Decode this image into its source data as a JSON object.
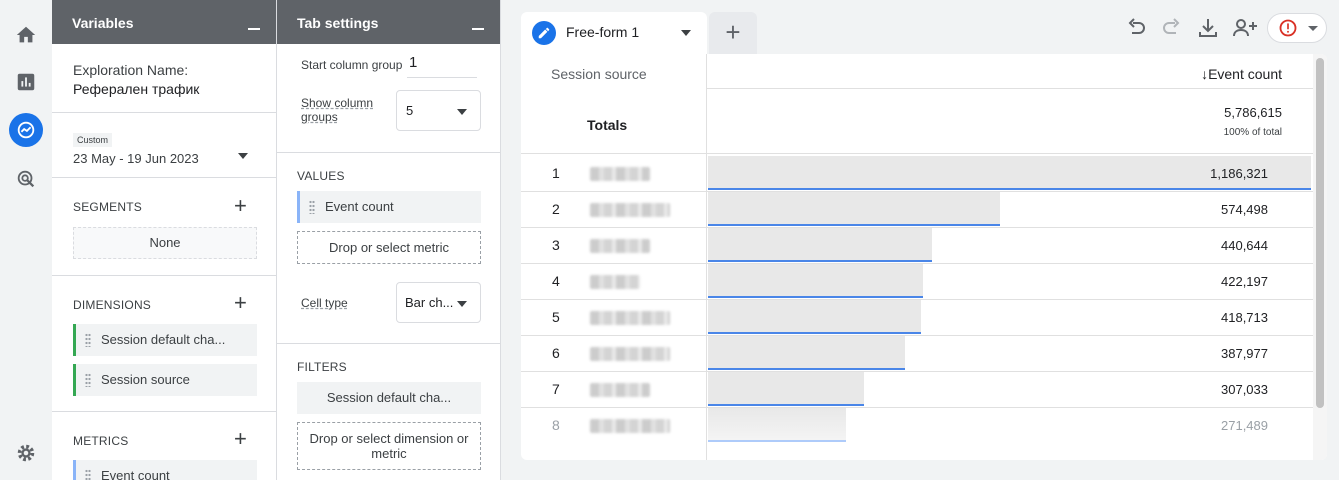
{
  "variables": {
    "title": "Variables",
    "exploration_label": "Exploration Name:",
    "exploration_name": "Реферален трафик",
    "date_badge": "Custom",
    "date_range": "23 May - 19 Jun 2023",
    "segments_title": "SEGMENTS",
    "segments_none": "None",
    "dimensions_title": "DIMENSIONS",
    "dimensions": [
      "Session default cha...",
      "Session source"
    ],
    "metrics_title": "METRICS",
    "metrics": [
      "Event count"
    ]
  },
  "tab_settings": {
    "title": "Tab settings",
    "start_column_group_label": "Start column group",
    "start_column_group_value": "1",
    "show_column_groups_label": "Show column groups",
    "show_column_groups_value": "5",
    "values_title": "VALUES",
    "values_chip": "Event count",
    "values_drop": "Drop or select metric",
    "cell_type_label": "Cell type",
    "cell_type_value": "Bar ch...",
    "filters_title": "FILTERS",
    "filters_chip": "Session default cha...",
    "filters_drop": "Drop or select dimension or metric"
  },
  "canvas": {
    "tab_label": "Free-form 1",
    "add_tab": "+",
    "table": {
      "dimension_header": "Session source",
      "metric_header": "↓Event count",
      "totals_label": "Totals",
      "totals_value": "5,786,615",
      "totals_sub": "100% of total",
      "rows": [
        {
          "rank": "1",
          "value": "1,186,321",
          "num": 1186321
        },
        {
          "rank": "2",
          "value": "574,498",
          "num": 574498
        },
        {
          "rank": "3",
          "value": "440,644",
          "num": 440644
        },
        {
          "rank": "4",
          "value": "422,197",
          "num": 422197
        },
        {
          "rank": "5",
          "value": "418,713",
          "num": 418713
        },
        {
          "rank": "6",
          "value": "387,977",
          "num": 387977
        },
        {
          "rank": "7",
          "value": "307,033",
          "num": 307033
        },
        {
          "rank": "8",
          "value": "271,489",
          "num": 271489
        }
      ]
    }
  },
  "icons": {
    "rail": [
      "home-icon",
      "reports-icon",
      "explore-icon",
      "advertising-icon",
      "settings-icon"
    ],
    "toolbar": [
      "undo-icon",
      "redo-icon",
      "download-icon",
      "share-icon",
      "alert-icon"
    ]
  },
  "colors": {
    "accent": "#1a73e8",
    "bar": "#e8e8e8",
    "bar_line": "#4a86e8",
    "dim_chip": "#34a853",
    "panel_head": "#5f6368"
  }
}
